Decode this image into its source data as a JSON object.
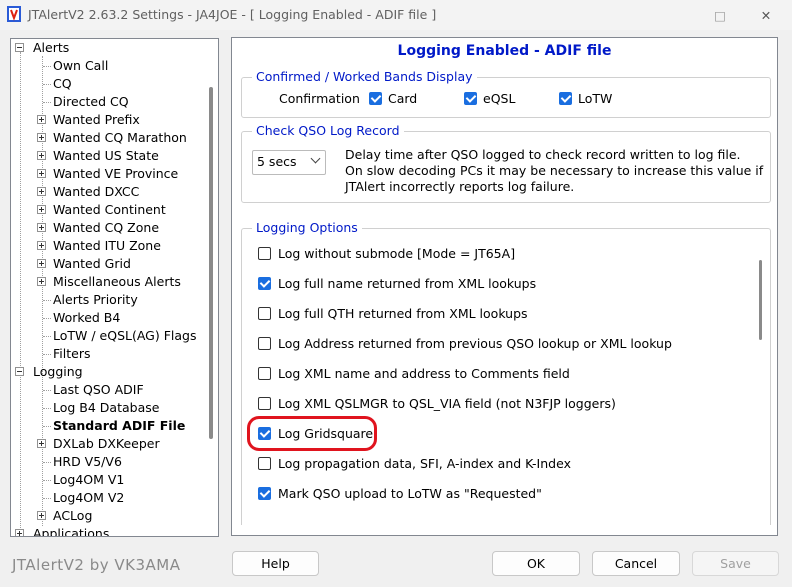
{
  "window": {
    "title": "JTAlertV2  2.63.2 Settings  -  JA4JOE  -  [ Logging Enabled - ADIF file ]",
    "maximize_glyph": "□",
    "close_glyph": "✕"
  },
  "tree": {
    "items": [
      {
        "label": "Alerts",
        "level": 0,
        "expander": "minus"
      },
      {
        "label": "Own Call",
        "level": 1,
        "expander": "none"
      },
      {
        "label": "CQ",
        "level": 1,
        "expander": "none"
      },
      {
        "label": "Directed CQ",
        "level": 1,
        "expander": "none"
      },
      {
        "label": "Wanted Prefix",
        "level": 1,
        "expander": "plus"
      },
      {
        "label": "Wanted CQ Marathon",
        "level": 1,
        "expander": "plus"
      },
      {
        "label": "Wanted US State",
        "level": 1,
        "expander": "plus"
      },
      {
        "label": "Wanted VE Province",
        "level": 1,
        "expander": "plus"
      },
      {
        "label": "Wanted DXCC",
        "level": 1,
        "expander": "plus"
      },
      {
        "label": "Wanted Continent",
        "level": 1,
        "expander": "plus"
      },
      {
        "label": "Wanted CQ Zone",
        "level": 1,
        "expander": "plus"
      },
      {
        "label": "Wanted ITU Zone",
        "level": 1,
        "expander": "plus"
      },
      {
        "label": "Wanted Grid",
        "level": 1,
        "expander": "plus"
      },
      {
        "label": "Miscellaneous Alerts",
        "level": 1,
        "expander": "plus"
      },
      {
        "label": "Alerts Priority",
        "level": 1,
        "expander": "none"
      },
      {
        "label": "Worked B4",
        "level": 1,
        "expander": "none"
      },
      {
        "label": "LoTW / eQSL(AG) Flags",
        "level": 1,
        "expander": "none"
      },
      {
        "label": "Filters",
        "level": 1,
        "expander": "none"
      },
      {
        "label": "Logging",
        "level": 0,
        "expander": "minus"
      },
      {
        "label": "Last QSO ADIF",
        "level": 1,
        "expander": "none"
      },
      {
        "label": "Log B4 Database",
        "level": 1,
        "expander": "none"
      },
      {
        "label": "Standard ADIF File",
        "level": 1,
        "expander": "none",
        "selected": true
      },
      {
        "label": "DXLab DXKeeper",
        "level": 1,
        "expander": "plus"
      },
      {
        "label": "HRD V5/V6",
        "level": 1,
        "expander": "none"
      },
      {
        "label": "Log4OM V1",
        "level": 1,
        "expander": "none"
      },
      {
        "label": "Log4OM V2",
        "level": 1,
        "expander": "none"
      },
      {
        "label": "ACLog",
        "level": 1,
        "expander": "plus"
      },
      {
        "label": "Applications",
        "level": 0,
        "expander": "plus"
      }
    ]
  },
  "panel": {
    "title": "Logging Enabled - ADIF file",
    "confirmed": {
      "legend": "Confirmed / Worked Bands Display",
      "label": "Confirmation",
      "options": [
        {
          "label": "Card",
          "checked": true
        },
        {
          "label": "eQSL",
          "checked": true
        },
        {
          "label": "LoTW",
          "checked": true
        }
      ]
    },
    "check_qso": {
      "legend": "Check QSO Log Record",
      "delay_value": "5 secs",
      "description": [
        "Delay time after QSO logged to check record written to log file.",
        "On slow decoding PCs it may be necessary to increase this value if",
        "JTAlert incorrectly reports log failure."
      ]
    },
    "logging_options": {
      "legend": "Logging Options",
      "options": [
        {
          "label": "Log without submode [Mode = JT65A]",
          "checked": false
        },
        {
          "label": "Log full name returned from XML lookups",
          "checked": true
        },
        {
          "label": "Log full QTH returned from XML lookups",
          "checked": false
        },
        {
          "label": "Log Address returned from previous QSO lookup or XML lookup",
          "checked": false
        },
        {
          "label": "Log XML name and address to Comments field",
          "checked": false
        },
        {
          "label": "Log XML QSLMGR to QSL_VIA field (not N3FJP loggers)",
          "checked": false
        },
        {
          "label": "Log Gridsquare",
          "checked": true,
          "highlighted": true
        },
        {
          "label": "Log propagation data, SFI, A-index and K-Index",
          "checked": false
        },
        {
          "label": "Mark QSO upload to LoTW as \"Requested\"",
          "checked": true
        }
      ]
    }
  },
  "footer": {
    "branding": "JTAlertV2 by VK3AMA",
    "help": "Help",
    "ok": "OK",
    "cancel": "Cancel",
    "save": "Save"
  },
  "colors": {
    "accent": "#0019c8",
    "checkbox": "#1a6ee0",
    "highlight": "#e0141e"
  }
}
